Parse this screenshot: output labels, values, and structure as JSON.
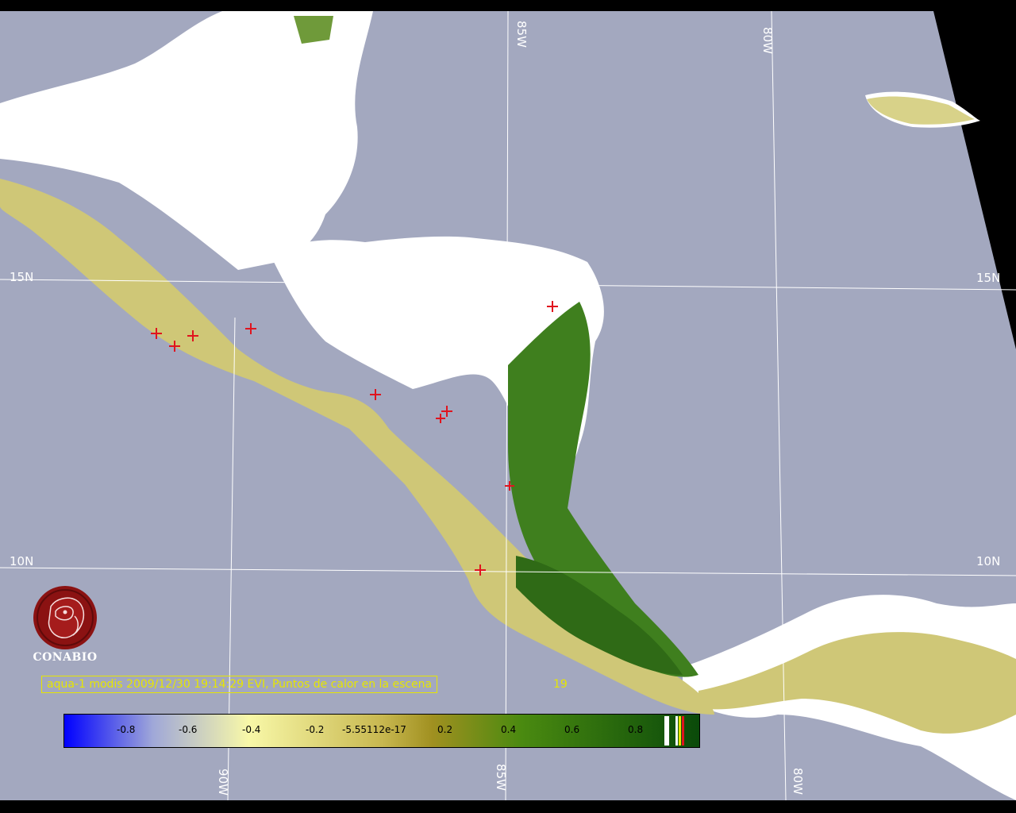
{
  "map": {
    "grid_labels": {
      "lat_15n_left": "15N",
      "lat_15n_right": "15N",
      "lat_10n_left": "10N",
      "lat_10n_right": "10N",
      "lon_85w_top": "85W",
      "lon_80w_top": "80W",
      "lon_90w_bottom": "90W",
      "lon_85w_bottom": "85W",
      "lon_80w_bottom": "80W"
    },
    "hotspot_marker": "red-cross",
    "hotspot_count": 19,
    "colors": {
      "ocean": "#a3a8bf",
      "cloud": "#ffffff",
      "land_dry": "#cfc777",
      "land_green": "#3f7f1e",
      "hotspot": "#e0141e",
      "caption": "#e6e600"
    }
  },
  "logo": {
    "name": "CONABIO",
    "icon": "conabio-macaw-icon"
  },
  "caption": {
    "text": "aqua-1 modis 2009/12/30 19:14:29 EVI, Puntos de calor en la escena",
    "count": "19"
  },
  "colorbar": {
    "ticks": [
      "-0.8",
      "-0.6",
      "-0.4",
      "-0.2",
      "-5.55112e-17",
      "0.2",
      "0.4",
      "0.6",
      "0.8"
    ],
    "stops": [
      "#0000ff",
      "#a0a8d8",
      "#f8f8a8",
      "#c8b850",
      "#a09020",
      "#4a8a10",
      "#0a4a0a"
    ]
  }
}
